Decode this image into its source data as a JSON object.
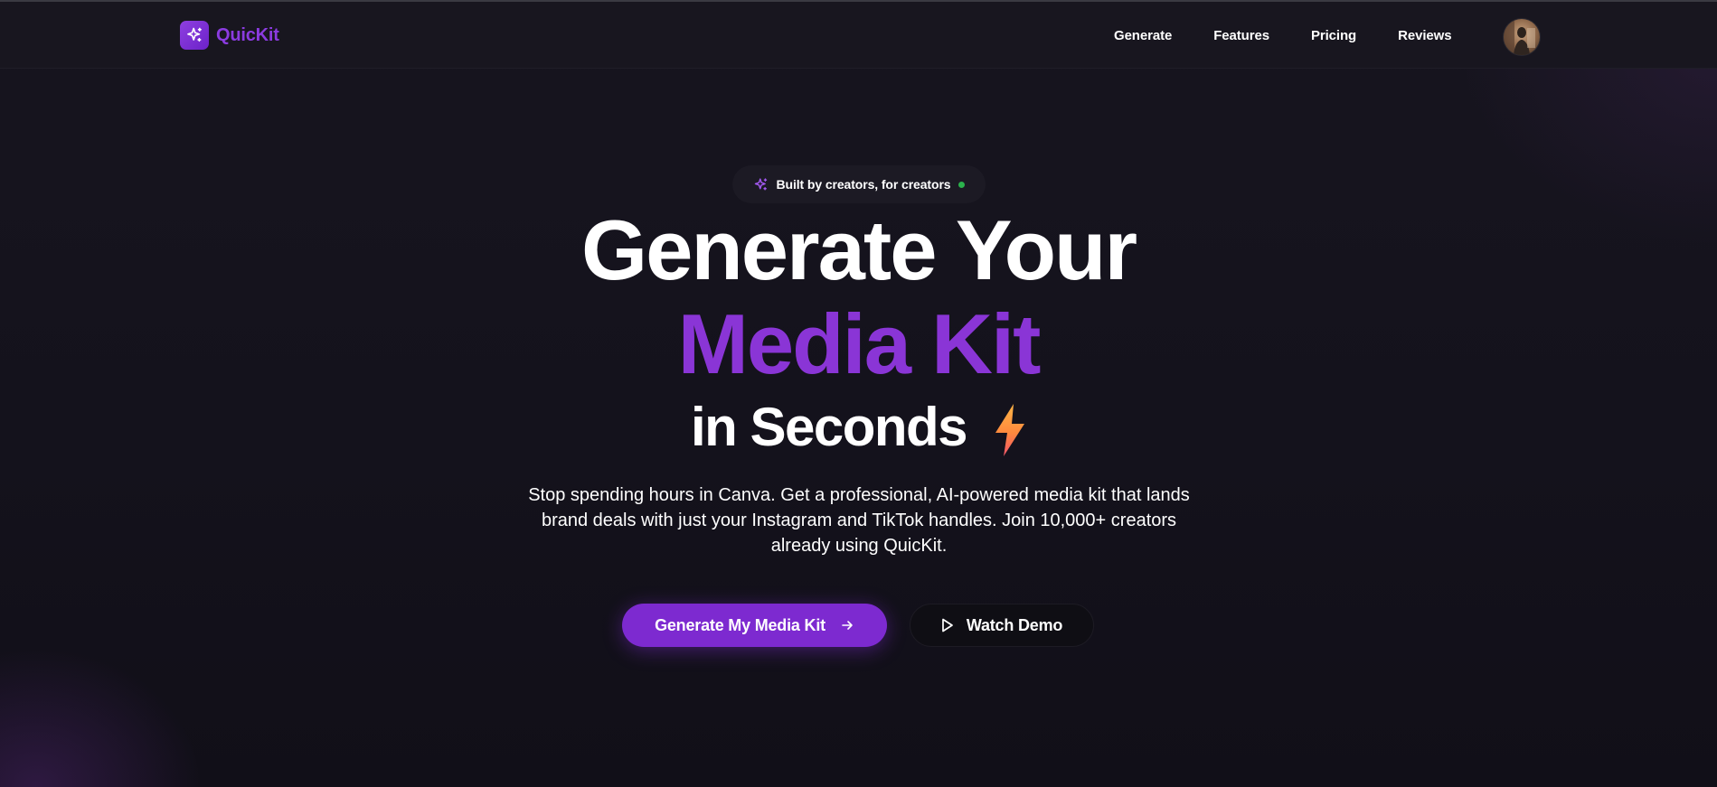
{
  "brand": {
    "name": "QuicKit",
    "logo_icon": "sparkles-icon",
    "accent_color": "#7d2ad0"
  },
  "nav": {
    "links": [
      {
        "label": "Generate"
      },
      {
        "label": "Features"
      },
      {
        "label": "Pricing"
      },
      {
        "label": "Reviews"
      }
    ],
    "avatar_icon": "user-avatar"
  },
  "hero": {
    "badge": {
      "icon": "sparkles-icon",
      "text": "Built by creators, for creators",
      "status_color": "#2bb24c"
    },
    "headline_line1": "Generate Your",
    "headline_line2": "Media Kit",
    "headline_line3": "in Seconds",
    "headline_icon": "lightning-bolt-icon",
    "subtitle": "Stop spending hours in Canva. Get a professional, AI-powered media kit that lands brand deals with just your Instagram and TikTok handles. Join 10,000+ creators already using QuicKit."
  },
  "cta": {
    "primary_label": "Generate My Media Kit",
    "primary_icon": "arrow-right-icon",
    "secondary_label": "Watch Demo",
    "secondary_icon": "play-icon"
  }
}
